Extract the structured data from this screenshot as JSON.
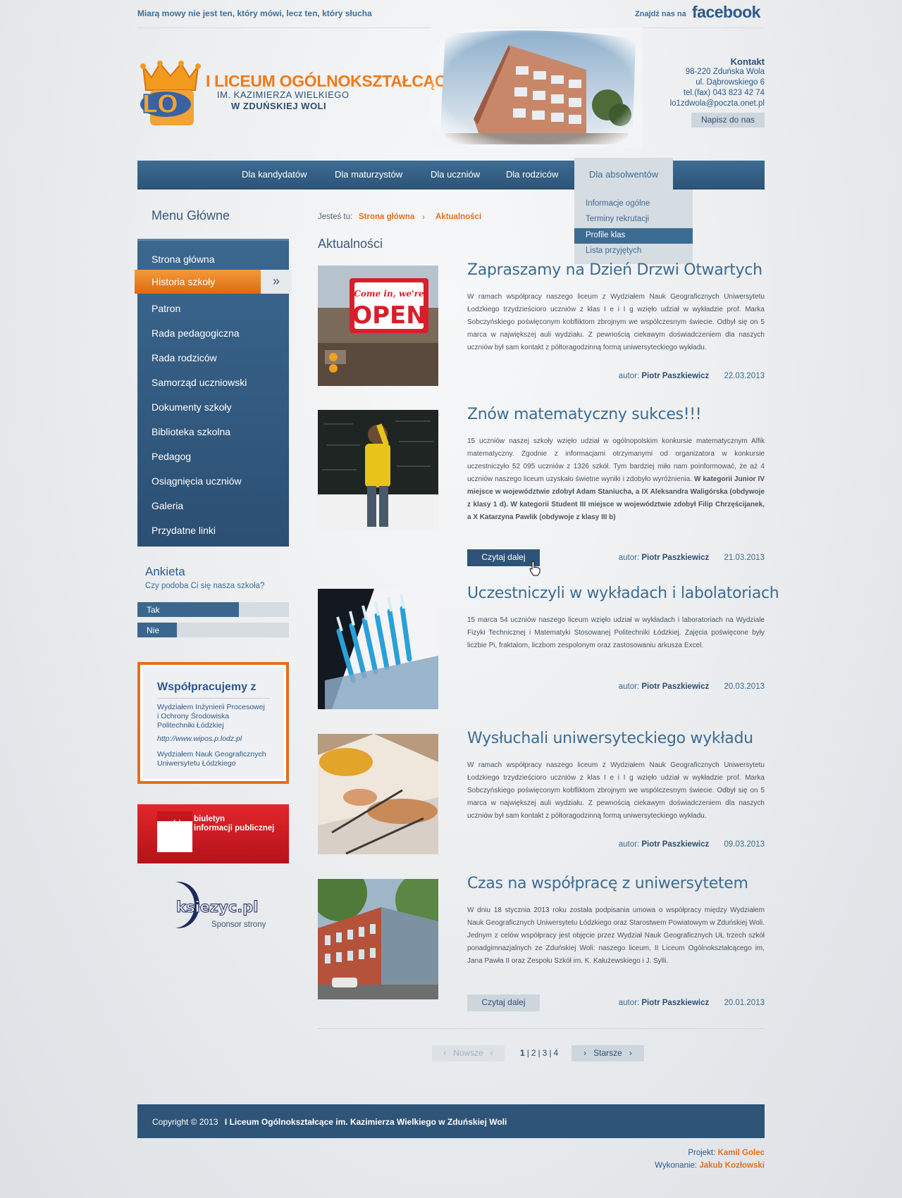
{
  "topbar": {
    "motto": "Miarą mowy nie jest ten, który mówi, lecz ten, który słucha",
    "fb_label": "Znajdź nas na",
    "fb_logo": "facebook"
  },
  "header": {
    "logo_mark": "LO",
    "title": "I LICEUM OGÓLNOKSZTAŁCĄCE",
    "subtitle": "IM. KAZIMIERZA WIELKIEGO",
    "subtitle2": "W ZDUŃSKIEJ WOLI"
  },
  "contact": {
    "title": "Kontakt",
    "lines": [
      "98-220 Zduńska Wola",
      "ul. Dąbrowskiego 6",
      "tel.(fax) 043 823 42 74",
      "lo1zdwola@poczta.onet.pl"
    ],
    "button": "Napisz do nas"
  },
  "nav": {
    "items": [
      "Dla kandydatów",
      "Dla maturzystów",
      "Dla uczniów",
      "Dla rodziców"
    ],
    "active": "Dla absolwentów",
    "dropdown": [
      "Informacje ogólne",
      "Terminy rekrutacji",
      "Profile klas",
      "Lista przyjętych"
    ]
  },
  "sidebar": {
    "title": "Menu Główne",
    "items": [
      "Strona główna",
      "Historia szkoły",
      "Patron",
      "Rada pedagogiczna",
      "Rada rodziców",
      "Samorząd uczniowski",
      "Dokumenty szkoły",
      "Biblioteka szkolna",
      "Pedagog",
      "Osiągnięcia uczniów",
      "Galeria",
      "Przydatne linki"
    ],
    "active_index": 1
  },
  "poll": {
    "title": "Ankieta",
    "question": "Czy podoba Ci się nasza szkoła?",
    "options": [
      {
        "label": "Tak",
        "fraction": 0.67
      },
      {
        "label": "Nie",
        "fraction": 0.26
      }
    ]
  },
  "partners": {
    "title": "Współpracujemy z",
    "line1": "Wydziałem Inżynierii Procesowej",
    "line2": "i Ochrony Środowiska",
    "line3": "Politechniki Łódzkiej",
    "link": "http://www.wipos.p.lodz.pl",
    "line4": "Wydziałem Nauk Geograficznych",
    "line5": "Uniwersytetu Łódzkiego"
  },
  "bip": {
    "logo": "bip",
    "line1": "biuletyn",
    "line2": "informacji publicznej"
  },
  "sponsor": {
    "name": "ksiezyc.pl",
    "label": "Sponsor strony"
  },
  "breadcrumb": {
    "label": "Jesteś tu:",
    "home": "Strona główna",
    "current": "Aktualności"
  },
  "section_title": "Aktualności",
  "articles": [
    {
      "title": "Zapraszamy na Dzień Drzwi Otwartych",
      "body": "W ramach współpracy naszego liceum z Wydziałem Nauk Geograficznych Uniwersytetu Łodzkiego trzydzieścioro uczniów z klas I e i I g wzięło udział w wykładzie prof. Marka Sobczyńskiego poświęconym kobfliktom zbrojnym we wspólczesnym świecie. Odbył się on 5 marca w największej auli wydziału. Z pewnością ciekawym doświadczeniem dla naszych uczniów był sam kontakt z półtoragodzinną formą uniwersyteckiego wykładu.",
      "author_label": "autor:",
      "author": "Piotr Paszkiewicz",
      "date": "22.03.2013",
      "sign_line1": "Come in, we're",
      "sign_line2": "OPEN"
    },
    {
      "title": "Znów matematyczny sukces!!!",
      "body": "15 uczniów naszej szkoły wzięło udział w ogólnopolskim konkursie matematycznym Alfik matematyczny. Zgodnie z informacjami otrzymanymi od organizatora w konkursie uczestniczyło 52 095 uczniów z 1326 szkół. Tym bardziej miło nam poinformować, że aż 4 uczniów naszego liceum uzyskało świetne wyniki i zdobyło wyróżnienia.",
      "body_bold": "W kategorii Junior IV miejsce w województwie zdobył Adam Staniucha, a IX Aleksandra Waligórska (obdywoje z klasy 1 d). W kategorii Student III miejsce w województwie zdobył Filip Chrzęścijanek, a X Katarzyna Pawlik (obdywoje z klasy III b)",
      "button": "Czytaj dalej",
      "author_label": "autor:",
      "author": "Piotr Paszkiewicz",
      "date": "21.03.2013"
    },
    {
      "title": "Uczestniczyli w wykładach i labolatoriach",
      "body": "15 marca 54 uczniów naszego liceum wzięło udział w wykładach i laboratoriach na Wydziale Fizyki Technicznej i Matematyki Stosowanej Politechniki Łódzkiej. Zajęcia poświęcone były liczbie Pi, fraktalom, liczbom zespolonym oraz zastosowaniu arkusza Excel.",
      "author_label": "autor:",
      "author": "Piotr Paszkiewicz",
      "date": "20.03.2013"
    },
    {
      "title": "Wysłuchali uniwersyteckiego wykładu",
      "body": "W ramach współpracy naszego liceum z Wydziałem Nauk Geograficznych Uniwersytetu Łodzkiego trzydzieścioro uczniów z klas I e i I g wzięło udział w wykładzie prof. Marka Sobczyńskiego poświęconym kobfliktom zbrojnym we wspólczesnym świecie. Odbył się on 5 marca w największej auli wydziału. Z pewnością ciekawym doświadczeniem dla naszych uczniów był sam kontakt z półtoragodzinną formą uniwersyteckiego wykładu.",
      "author_label": "autor:",
      "author": "Piotr Paszkiewicz",
      "date": "09.03.2013"
    },
    {
      "title": "Czas na współpracę z uniwersytetem",
      "body": "W dniu 18 stycznia 2013 roku została podpisania umowa o współpracy między Wydziałem Nauk Geograficznych Uniwersytetu Łódzkiego oraz Starostwem Powiatowym w Zduńskiej Woli. Jednym z celów współpracy jest objęcie przez Wydział Nauk Geograficznych UŁ trzech szkół ponadgimnazjalnych ze Zduńskiej Woli: naszego liceum, II Liceum Ogólnokształcącego im, Jana Pawła II oraz Zespołu Szkół im. K. Kałużewskiego i J. Sylli.",
      "button": "Czytaj dalej",
      "author_label": "autor:",
      "author": "Piotr Paszkiewicz",
      "date": "20.01.2013"
    }
  ],
  "pagination": {
    "prev": "Nowsze",
    "next": "Starsze",
    "pages": [
      "1",
      "2",
      "3",
      "4"
    ],
    "current": 1
  },
  "footer": {
    "copyright": "Copyright © 2013",
    "school": "I Liceum Ogólnokształcące im. Kazimierza Wielkiego w Zduńskiej Woli"
  },
  "credits": {
    "project_label": "Projekt:",
    "project": "Kamil Golec",
    "exec_label": "Wykonanie:",
    "exec": "Jakub Kozłowski"
  },
  "colors": {
    "accent": "#e2701f",
    "primary": "#2d5478",
    "link": "#3d6c93"
  }
}
